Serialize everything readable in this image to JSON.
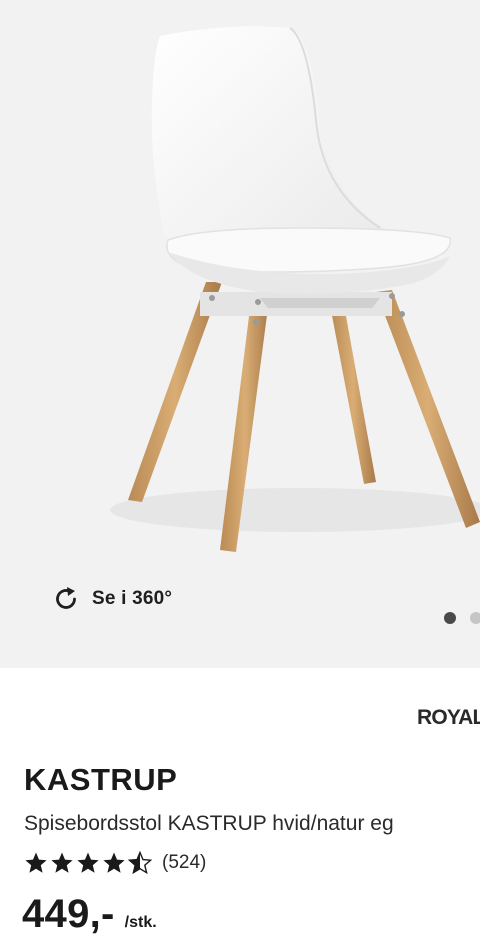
{
  "gallery": {
    "view360_label": "Se i 360°",
    "view360_icon": "rotate-icon",
    "slide_count": 2,
    "active_slide": 1,
    "background_color": "#f2f2f2"
  },
  "brand": {
    "logo_text": "ROYAL"
  },
  "product": {
    "name": "KASTRUP",
    "description": "Spisebordsstol KASTRUP hvid/natur eg",
    "rating": 4.5,
    "rating_max": 5,
    "rating_count": "(524)",
    "price": "449,-",
    "unit": "/stk."
  }
}
